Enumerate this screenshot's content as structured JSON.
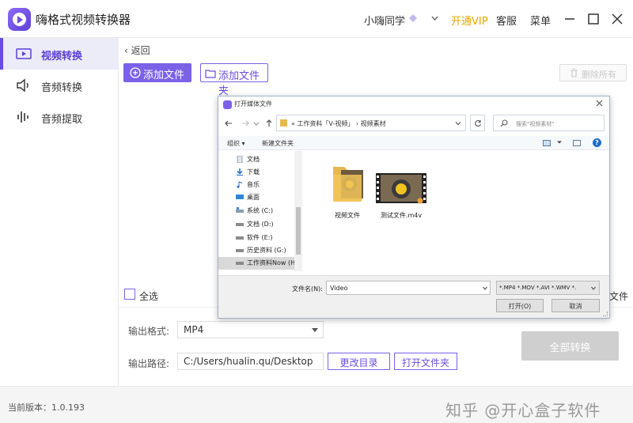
{
  "app": {
    "title": "嗨格式视频转换器",
    "user_name": "小嗨同学",
    "vip_label": "开通VIP",
    "service_label": "客服",
    "menu_label": "菜单"
  },
  "sidebar": {
    "items": [
      {
        "label": "视频转换",
        "icon": "video-convert-icon",
        "active": true
      },
      {
        "label": "音频转换",
        "icon": "speaker-icon",
        "active": false
      },
      {
        "label": "音频提取",
        "icon": "waveform-icon",
        "active": false
      }
    ]
  },
  "main": {
    "back_label": "返回",
    "add_file_label": "添加文件",
    "add_folder_label": "添加文件夹",
    "delete_all_label": "删除所有",
    "select_all_label": "全选",
    "right_file_label": "文件",
    "output_format_label": "输出格式:",
    "output_format_value": "MP4",
    "output_path_label": "输出路径:",
    "output_path_value": "C:/Users/hualin.qu/Desktop",
    "change_dir_label": "更改目录",
    "open_folder_label": "打开文件夹",
    "convert_all_label": "全部转换"
  },
  "status": {
    "version": "当前版本：1.0.193",
    "watermark": "知乎 @开心盒子软件"
  },
  "dialog": {
    "title": "打开媒体文件",
    "address_path": "«  工作资料「V-视频」  ›  视频素材",
    "search_placeholder": "搜索\"视频素材\"",
    "organize_label": "组织 ▾",
    "new_folder_label": "新建文件夹",
    "help_label": "?",
    "nav_items": [
      {
        "label": "文档",
        "icon": "document-icon"
      },
      {
        "label": "下载",
        "icon": "download-icon"
      },
      {
        "label": "音乐",
        "icon": "music-icon"
      },
      {
        "label": "桌面",
        "icon": "desktop-icon"
      },
      {
        "label": "系统 (C:)",
        "icon": "drive-icon"
      },
      {
        "label": "文档 (D:)",
        "icon": "drive-icon"
      },
      {
        "label": "软件 (E:)",
        "icon": "drive-icon"
      },
      {
        "label": "历史资料 (G:)",
        "icon": "drive-icon"
      },
      {
        "label": "工作资料Now (H:)",
        "icon": "drive-icon",
        "selected": true
      }
    ],
    "files": [
      {
        "name": "视频文件",
        "kind": "folder"
      },
      {
        "name": "测试文件.m4v",
        "kind": "video"
      }
    ],
    "filename_label": "文件名(N):",
    "filename_value": "Video",
    "filetype_value": "*.MP4 *.MOV *.AVI *.WMV *.",
    "open_label": "打开(O)",
    "cancel_label": "取消"
  },
  "colors": {
    "accent": "#7b61e8",
    "vip": "#e6a600",
    "disabled": "#cfcfcf"
  }
}
